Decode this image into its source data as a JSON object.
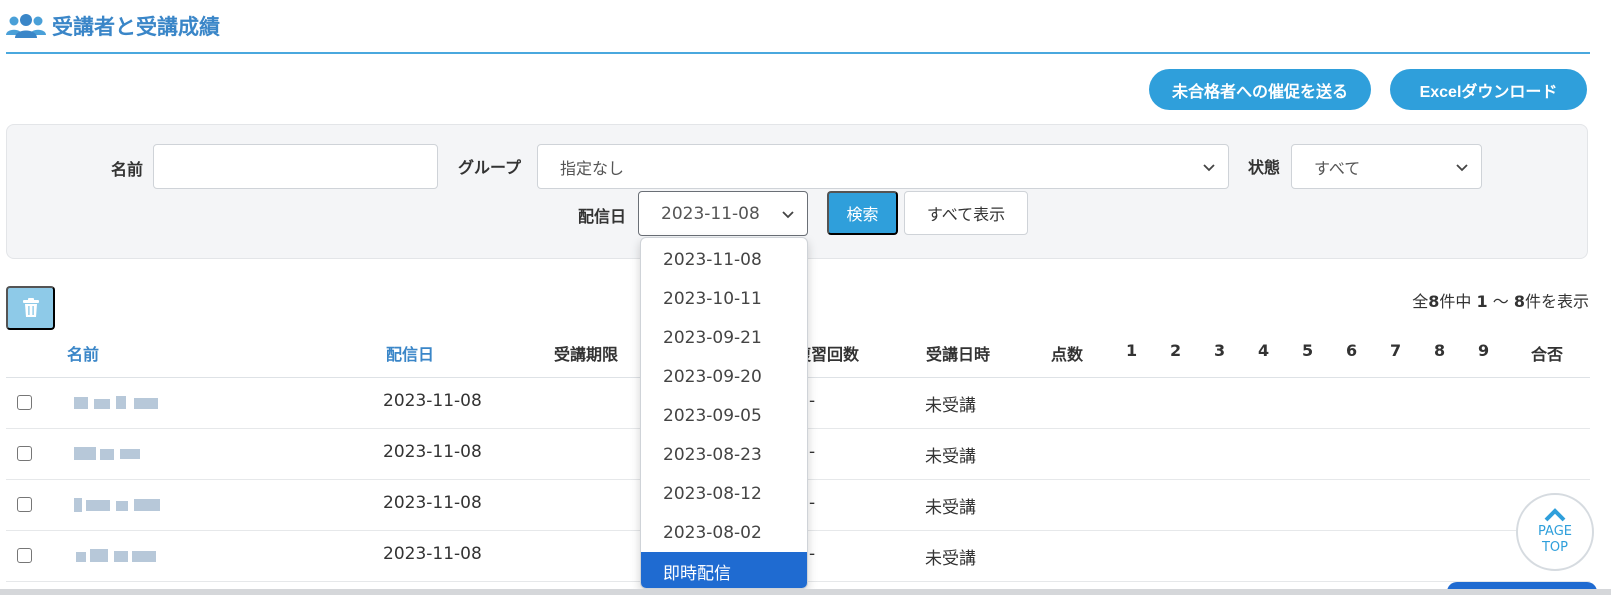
{
  "header": {
    "title": "受講者と受講成績",
    "icon": "users-icon"
  },
  "actions": {
    "remind_label": "未合格者への催促を送る",
    "excel_label": "Excelダウンロード"
  },
  "filters": {
    "name_label": "名前",
    "name_value": "",
    "group_label": "グループ",
    "group_value": "指定なし",
    "status_label": "状態",
    "status_value": "すべて",
    "date_label": "配信日",
    "date_value": "2023-11-08",
    "search_label": "検索",
    "show_all_label": "すべて表示"
  },
  "dropdown": {
    "options": [
      "2023-11-08",
      "2023-10-11",
      "2023-09-21",
      "2023-09-20",
      "2023-09-05",
      "2023-08-23",
      "2023-08-12",
      "2023-08-02",
      "即時配信"
    ],
    "highlighted": "即時配信"
  },
  "count": {
    "prefix": "全",
    "total": "8",
    "mid": "件中 ",
    "from": "1",
    "sep": " 〜 ",
    "to": "8",
    "suffix": "件を表示"
  },
  "table": {
    "columns": [
      "名前",
      "配信日",
      "受講期限",
      "復習回数",
      "受講日時",
      "点数",
      "1",
      "2",
      "3",
      "4",
      "5",
      "6",
      "7",
      "8",
      "9",
      "合否"
    ],
    "rows": [
      {
        "date": "2023-11-08",
        "review": "-",
        "status": "未受講"
      },
      {
        "date": "2023-11-08",
        "review": "-",
        "status": "未受講"
      },
      {
        "date": "2023-11-08",
        "review": "-",
        "status": "未受講"
      },
      {
        "date": "2023-11-08",
        "review": "-",
        "status": "未受講"
      }
    ]
  },
  "pagetop": {
    "line1": "PAGE",
    "line2": "TOP"
  },
  "colors": {
    "accent": "#2f9fdb",
    "title": "#3a86c8",
    "selected": "#1f6bd1"
  }
}
